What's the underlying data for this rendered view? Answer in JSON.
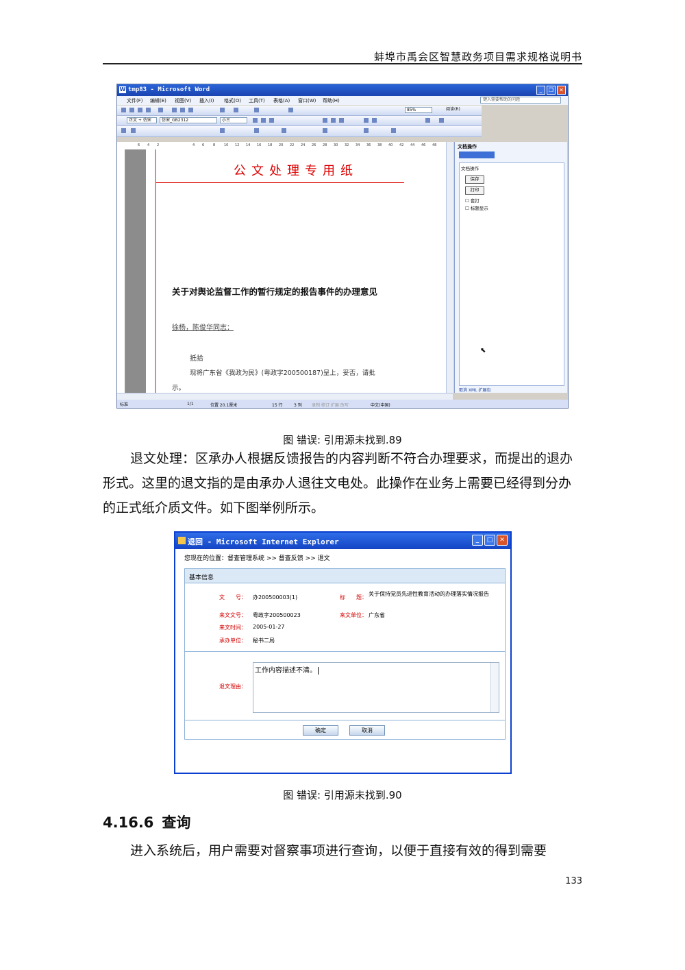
{
  "header": {
    "title": "蚌埠市禹会区智慧政务项目需求规格说明书"
  },
  "word_window": {
    "title": "tmp83 - Microsoft Word",
    "menu": [
      "文件(F)",
      "编辑(E)",
      "视图(V)",
      "插入(I)",
      "格式(O)",
      "工具(T)",
      "表格(A)",
      "窗口(W)",
      "帮助(H)"
    ],
    "help_box": "键入需要帮助的问题",
    "style_field": "正文 + 仿宋",
    "font_field": "仿宋_GB2312",
    "size_field": "小三",
    "zoom_field": "85%",
    "read_label": "阅读(R)",
    "ruler_numbers": [
      "6",
      "4",
      "2",
      "2",
      "4",
      "6",
      "8",
      "10",
      "12",
      "14",
      "16",
      "18",
      "20",
      "22",
      "24",
      "26",
      "28",
      "30",
      "32",
      "34",
      "36",
      "38",
      "40",
      "42",
      "44",
      "46",
      "48"
    ],
    "doc": {
      "letterhead": "公文处理专用纸",
      "heading": "关于对舆论监督工作的暂行规定的报告事件的办理意见",
      "to_line": "徐杨，陈俊华同志：",
      "line1": "抵拾",
      "line2": "现将广东省《我政为民》(粤政字200500187)呈上，妥否，请批",
      "line3": "示。"
    },
    "pane": {
      "title": "文档操作",
      "group": "文档操作",
      "save": "保存",
      "print": "打印",
      "check1": "套打",
      "check2": "标题显示",
      "footer": "取消 XML 扩展包"
    },
    "status": {
      "page": "1/1",
      "position": "位置 20.1厘米",
      "line": "15 行",
      "col": "3 列",
      "flags": "录制  修订  扩展  改写",
      "lang": "中文(中国)",
      "view": "标准"
    }
  },
  "caption1": "图 错误: 引用源未找到.89",
  "para1": "退文处理：区承办人根据反馈报告的内容判断不符合办理要求，而提出的退办形式。这里的退文指的是由承办人退往文电处。此操作在业务上需要已经得到分办的正式纸介质文件。如下图举例所示。",
  "ie_window": {
    "title": "退回 - Microsoft Internet Explorer",
    "breadcrumb": "您现在的位置：督查管理系统 >> 督查反馈 >> 退文",
    "section": "基本信息",
    "fields": {
      "doc_no_label": "文　　号：",
      "doc_no": "办200500003(1)",
      "title_label": "标　　题：",
      "title": "关于保持党员先进性教育活动的办理落实情况报告",
      "incoming_no_label": "来文文号：",
      "incoming_no": "粤政字200500023",
      "incoming_unit_label": "来文单位：",
      "incoming_unit": "广东省",
      "incoming_time_label": "来文时间：",
      "incoming_time": "2005-01-27",
      "handler_label": "承办单位：",
      "handler": "秘书二局",
      "reason_label": "退文理由：",
      "reason": "工作内容描述不清。"
    },
    "ok": "确定",
    "cancel": "取消"
  },
  "caption2": "图 错误: 引用源未找到.90",
  "section": {
    "number": "4.16.6",
    "title": "查询"
  },
  "para2": "进入系统后，用户需要对督察事项进行查询，以便于直接有效的得到需要",
  "page_number": "133"
}
